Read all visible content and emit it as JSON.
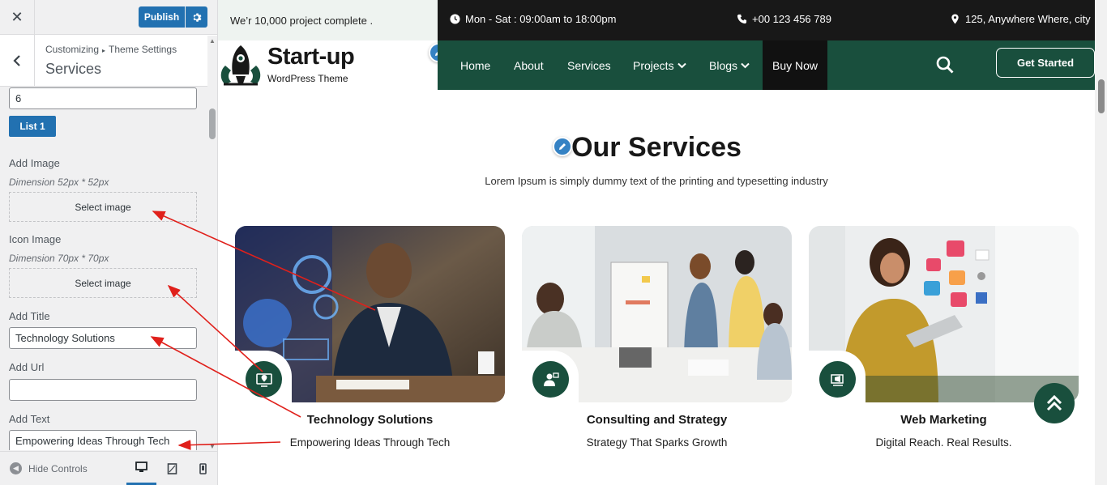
{
  "sidebar": {
    "close_label": "✕",
    "publish_label": "Publish",
    "breadcrumb": [
      "Customizing",
      "Theme Settings"
    ],
    "breadcrumb_sep": "▸",
    "section_title": "Services",
    "count_value": "6",
    "list_button": "List 1",
    "add_image": {
      "label": "Add Image",
      "dimension": "Dimension 52px * 52px",
      "button": "Select image"
    },
    "icon_image": {
      "label": "Icon Image",
      "dimension": "Dimension 70px * 70px",
      "button": "Select image"
    },
    "add_title": {
      "label": "Add Title",
      "value": "Technology Solutions"
    },
    "add_url": {
      "label": "Add Url",
      "value": ""
    },
    "add_text": {
      "label": "Add Text",
      "value": "Empowering Ideas Through Tech"
    },
    "hide_controls": "Hide Controls"
  },
  "topbar": {
    "promo": "We’r 10,000 project complete .",
    "hours": "Mon - Sat : 09:00am to 18:00pm",
    "phone": "+00 123 456 789",
    "address": "125, Anywhere Where, city"
  },
  "logo": {
    "title": "Start-up",
    "subtitle": "WordPress Theme"
  },
  "nav": {
    "items": [
      "Home",
      "About",
      "Services",
      "Projects",
      "Blogs",
      "Buy Now"
    ],
    "cta": "Get Started"
  },
  "services": {
    "title": "Our Services",
    "subtitle": "Lorem Ipsum is simply dummy text of the printing and typesetting industry",
    "cards": [
      {
        "title": "Technology Solutions",
        "text": "Empowering Ideas Through Tech"
      },
      {
        "title": "Consulting and Strategy",
        "text": "Strategy That Sparks Growth"
      },
      {
        "title": "Web Marketing",
        "text": "Digital Reach. Real Results."
      }
    ]
  },
  "colors": {
    "brand_green": "#194f3d",
    "wp_blue": "#2271b1",
    "topbar_dark": "#181818",
    "annotation_red": "#e0201b"
  }
}
